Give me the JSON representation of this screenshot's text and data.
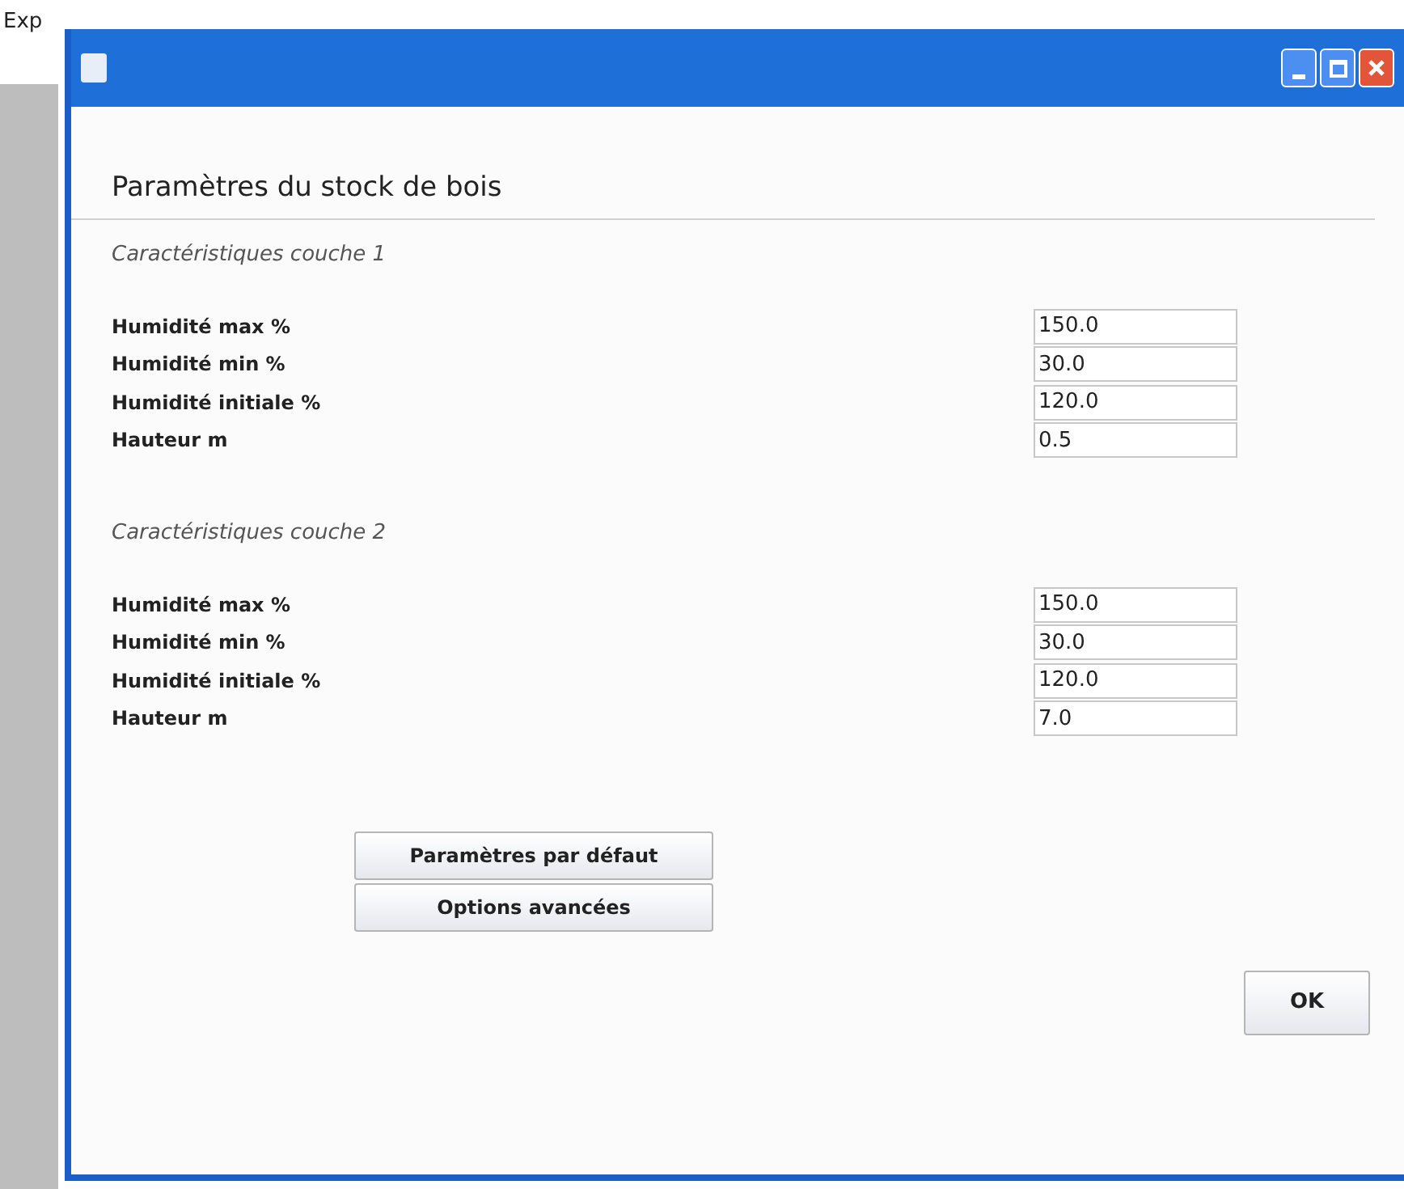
{
  "background_text": "Exp",
  "window": {
    "title": "Paramètres du stock de bois"
  },
  "sections": [
    {
      "heading": "Caractéristiques couche 1",
      "fields": [
        {
          "label": "Humidité max %",
          "value": "150.0"
        },
        {
          "label": "Humidité min %",
          "value": "30.0"
        },
        {
          "label": "Humidité initiale %",
          "value": "120.0"
        },
        {
          "label": "Hauteur m",
          "value": "0.5"
        }
      ]
    },
    {
      "heading": "Caractéristiques couche 2",
      "fields": [
        {
          "label": "Humidité max %",
          "value": "150.0"
        },
        {
          "label": "Humidité min %",
          "value": "30.0"
        },
        {
          "label": "Humidité initiale %",
          "value": "120.0"
        },
        {
          "label": "Hauteur m",
          "value": "7.0"
        }
      ]
    }
  ],
  "buttons": [
    "Paramètres par défaut",
    "Options avancées"
  ],
  "ok_button": "OK"
}
